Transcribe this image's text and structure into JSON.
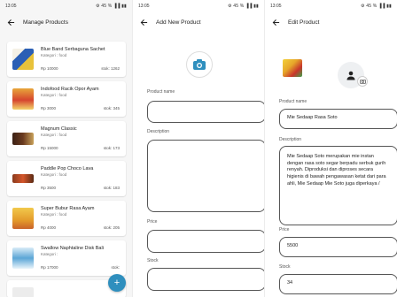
{
  "status_bar": {
    "time": "13:05",
    "icons": "⚙ 45 % ▐▐ ▮▮"
  },
  "colors": {
    "accent": "#2f8fbe",
    "text": "#222222",
    "muted": "#777777"
  },
  "list_screen": {
    "title": "Manage Products",
    "products": [
      {
        "name": "Blue Band Serbaguna Sachet",
        "category": "Kategori : food",
        "price": "Rp 10000",
        "stock": "stok: 1262"
      },
      {
        "name": "Indofood Racik Opor Ayam",
        "category": "Kategori : food",
        "price": "Rp 3000",
        "stock": "stok: 345"
      },
      {
        "name": "Magnum Classic",
        "category": "Kategori : food",
        "price": "Rp 15000",
        "stock": "stok: 173"
      },
      {
        "name": "Paddle Pop Choco Lava",
        "category": "Kategori : food",
        "price": "Rp 3500",
        "stock": "stok: 183"
      },
      {
        "name": "Super Bubur Rasa Ayam",
        "category": "Kategori : food",
        "price": "Rp 4000",
        "stock": "stok: 205"
      },
      {
        "name": "Swallow Naphtaline Disk Bali",
        "category": "Kategori :",
        "price": "Rp 17000",
        "stock": "stok:"
      }
    ],
    "fab_icon": "plus-icon"
  },
  "add_screen": {
    "title": "Add New Product",
    "labels": {
      "name": "Product name",
      "description": "Description",
      "price": "Price",
      "stock": "Stock"
    },
    "values": {
      "name": "",
      "description": "",
      "price": "",
      "stock": ""
    }
  },
  "edit_screen": {
    "title": "Edit Product",
    "labels": {
      "name": "Product name",
      "description": "Description",
      "price": "Price",
      "stock": "Stock"
    },
    "values": {
      "name": "Mie Sedaap Rasa Soto",
      "description": "Mie Sedaap Soto merupakan mie instan dengan rasa soto segar berpadu serbuk gurih renyah. Diproduksi dan diproses secara higienis di bawah pengawasan ketat dari para ahli, Mie Sedaap Mie Soto juga diperkaya /",
      "price": "5500",
      "stock": "34"
    }
  }
}
